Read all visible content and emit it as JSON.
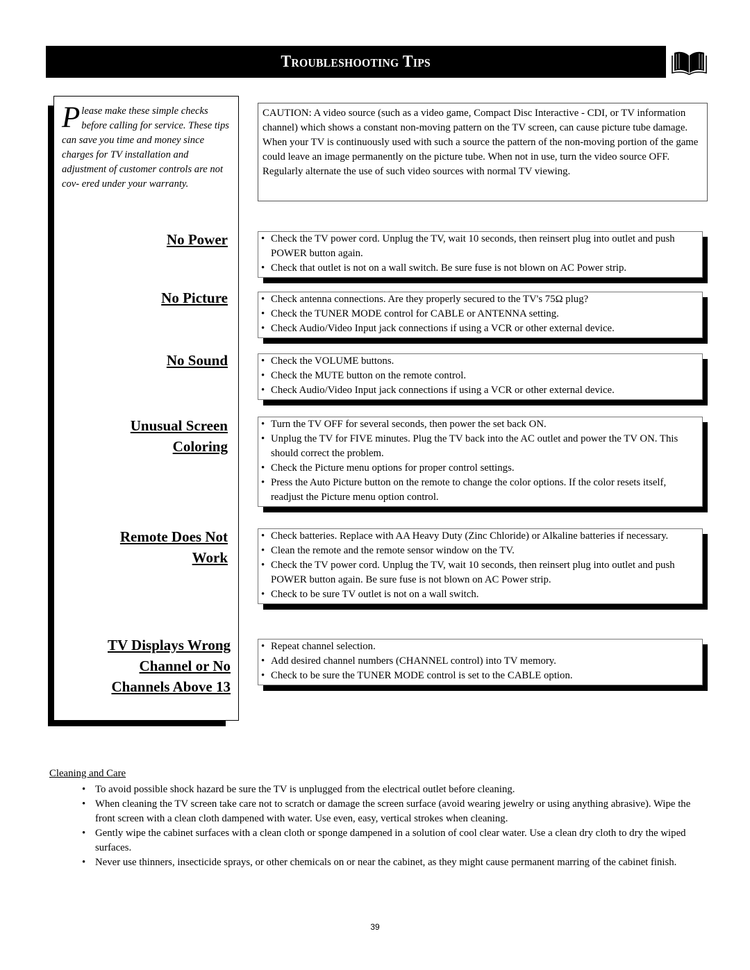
{
  "header": {
    "title": "Troubleshooting Tips",
    "icon": "open-book-icon"
  },
  "intro": {
    "dropcap": "P",
    "text": "lease make these simple checks before calling for service. These tips can save you time and money since charges for TV installation and adjustment of customer controls are not cov- ered under your warranty."
  },
  "caution": {
    "text": "CAUTION: A video source (such as a video game, Compact Disc Interactive - CDI, or TV information channel) which shows a constant non-moving pattern on the TV screen, can cause picture tube damage.  When your TV is continuously used with such a source the pattern of the non-moving portion of the game could leave an image permanently on the picture tube.  When not in use, turn the video source OFF.  Regularly alternate the use of such video sources with normal TV viewing."
  },
  "problems": [
    {
      "heading": [
        "No Power"
      ],
      "tips": [
        "Check the TV power cord.  Unplug the TV, wait 10 seconds, then reinsert plug into outlet and push POWER button again.",
        "Check that outlet is not on a wall switch. Be sure fuse is not blown on AC Power strip."
      ]
    },
    {
      "heading": [
        "No Picture"
      ],
      "tips": [
        "Check antenna connections.  Are they properly secured to the TV's 75Ω plug?",
        "Check the TUNER MODE control for CABLE or ANTENNA setting.",
        "Check Audio/Video Input jack connections if using a VCR or other external device."
      ]
    },
    {
      "heading": [
        "No Sound"
      ],
      "tips": [
        "Check the VOLUME buttons.",
        "Check the MUTE button on the remote control.",
        "Check Audio/Video Input jack connections if using a VCR or other external device."
      ]
    },
    {
      "heading": [
        "Unusual Screen",
        "Coloring"
      ],
      "tips": [
        "Turn the TV OFF for several seconds, then power the set back ON.",
        "Unplug the TV for FIVE minutes. Plug the TV back into the AC outlet and power the TV ON. This should correct the problem.",
        "Check the Picture menu options for proper control settings.",
        "Press the Auto Picture button on the remote to change the color options. If the color resets itself, readjust the Picture menu option control."
      ]
    },
    {
      "heading": [
        "Remote Does Not",
        "Work"
      ],
      "tips": [
        "Check batteries.  Replace with AA Heavy Duty (Zinc Chloride) or Alkaline batteries if necessary.",
        "Clean the remote and the remote sensor window on the TV.",
        "Check the TV power cord.  Unplug the TV, wait 10 seconds, then reinsert plug into outlet and push POWER button again. Be sure fuse is not blown on AC Power strip.",
        "Check to be sure TV outlet is not on a wall switch."
      ]
    },
    {
      "heading": [
        "TV Displays Wrong",
        "Channel or No",
        "Channels Above 13"
      ],
      "tips": [
        "Repeat channel selection.",
        "Add desired channel numbers (CHANNEL control) into TV memory.",
        "Check to be sure the TUNER MODE control is set to the CABLE option."
      ]
    }
  ],
  "cleaning": {
    "title": "Cleaning and Care",
    "items": [
      "To avoid possible shock hazard be sure the TV is unplugged from the electrical outlet before cleaning.",
      "When cleaning the TV screen take care not to scratch or damage the screen surface (avoid wearing jewelry or using anything abrasive). Wipe the front screen with a clean cloth dampened with water. Use even, easy, vertical strokes when cleaning.",
      "Gently wipe the cabinet surfaces with a clean cloth or sponge dampened in a solution of cool clear water. Use a clean dry cloth to dry the wiped surfaces.",
      "Never use thinners, insecticide sprays, or other chemicals on or near the cabinet, as they might cause permanent marring of the cabinet finish."
    ]
  },
  "footer": {
    "page_number": "39"
  }
}
